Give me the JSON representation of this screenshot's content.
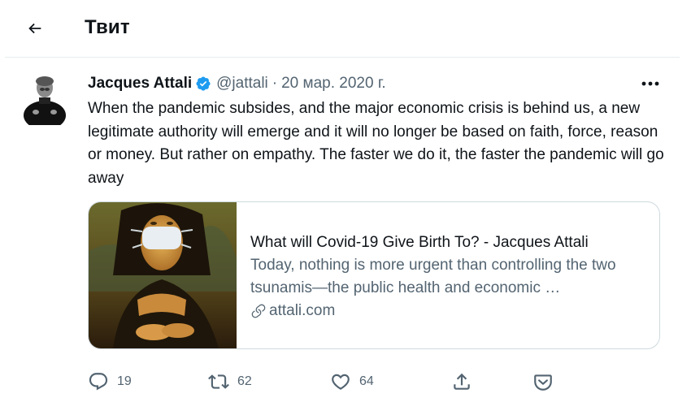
{
  "header": {
    "title": "Твит"
  },
  "tweet": {
    "author_name": "Jacques Attali",
    "handle": "@jattali",
    "separator": "·",
    "date": "20 мар. 2020 г.",
    "text": "When the pandemic subsides, and the major economic crisis is behind us, a new legitimate authority will emerge and it will no longer be based on faith, force, reason or money. But rather on empathy. The faster we do it, the faster the pandemic will go away"
  },
  "card": {
    "title": "What will Covid-19 Give Birth To? - Jacques Attali",
    "description": "Today, nothing is more urgent than controlling the two tsunamis—the public health and economic …",
    "domain": "attali.com"
  },
  "actions": {
    "replies": "19",
    "retweets": "62",
    "likes": "64"
  },
  "icons": {
    "back": "arrow-left-icon",
    "verified": "verified-badge-icon",
    "more": "more-horizontal-icon",
    "link": "link-icon",
    "reply": "reply-icon",
    "retweet": "retweet-icon",
    "like": "heart-icon",
    "share": "share-icon",
    "tip": "tip-icon"
  },
  "colors": {
    "verified": "#1d9bf0",
    "text": "#0f1419",
    "secondary": "#536471",
    "border": "#cfd9de"
  }
}
